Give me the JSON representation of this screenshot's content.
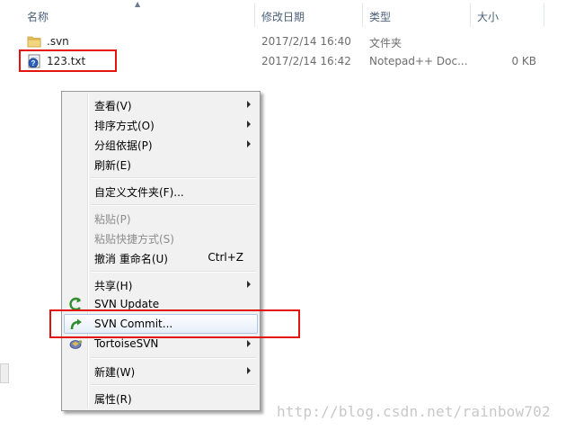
{
  "columns": {
    "name": "名称",
    "modified": "修改日期",
    "type": "类型",
    "size": "大小"
  },
  "files": [
    {
      "name": ".svn",
      "modified": "2017/2/14 16:40",
      "type": "文件夹",
      "size": "",
      "icon": "folder-icon"
    },
    {
      "name": "123.txt",
      "modified": "2017/2/14 16:42",
      "type": "Notepad++ Doc...",
      "size": "0 KB",
      "icon": "svn-unversioned-file-icon"
    }
  ],
  "context_menu": {
    "view": "查看(V)",
    "sort_by": "排序方式(O)",
    "group_by": "分组依据(P)",
    "refresh": "刷新(E)",
    "customize_folder": "自定义文件夹(F)...",
    "paste": "粘贴(P)",
    "paste_shortcut": "粘贴快捷方式(S)",
    "undo_rename": "撤消 重命名(U)",
    "undo_shortcut": "Ctrl+Z",
    "share": "共享(H)",
    "svn_update": "SVN Update",
    "svn_commit": "SVN Commit...",
    "tortoise_svn": "TortoiseSVN",
    "new": "新建(W)",
    "properties": "属性(R)"
  },
  "watermark": "http://blog.csdn.net/rainbow702",
  "colors": {
    "highlight_box": "#e3140f",
    "menu_background": "#f1f1f1",
    "header_text": "#4c607a"
  }
}
